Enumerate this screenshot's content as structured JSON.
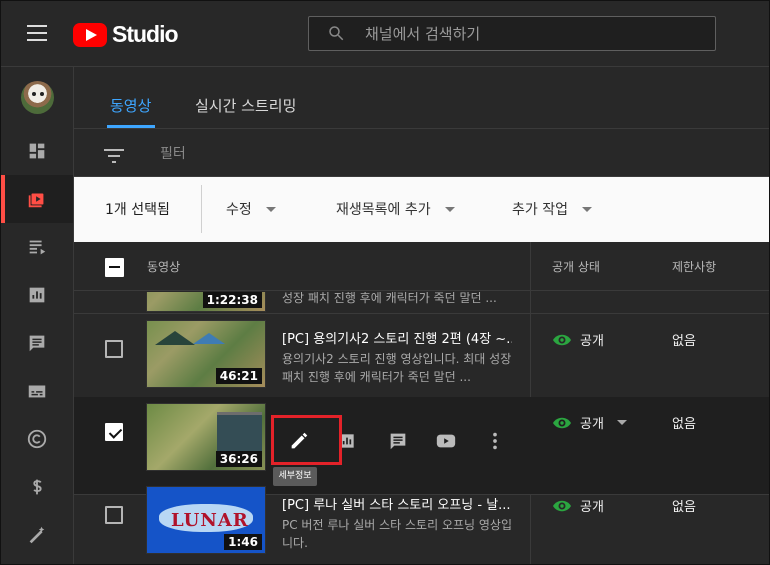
{
  "app": {
    "logo_text": "Studio"
  },
  "search": {
    "placeholder": "채널에서 검색하기"
  },
  "tabs": [
    {
      "label": "동영상"
    },
    {
      "label": "실시간 스트리밍"
    }
  ],
  "filter": {
    "label": "필터"
  },
  "actionbar": {
    "selected_count": "1개 선택됨",
    "edit_label": "수정",
    "add_to_playlist_label": "재생목록에 추가",
    "more_actions_label": "추가 작업"
  },
  "columns": {
    "video": "동영상",
    "visibility": "공개 상태",
    "restrictions": "제한사항"
  },
  "rows": [
    {
      "duration": "1:22:38",
      "desc_line": "성장 패치 진행 후에 캐릭터가 죽던 말던 ..."
    },
    {
      "title": "[PC] 용의기사2 스토리 진행 2편 (4장 ~...",
      "description": "용의기사2 스토리 진행 영상입니다. 최대 성장 패치 진행 후에 캐릭터가 죽던 말던 ...",
      "duration": "46:21",
      "visibility": "공개",
      "restrictions": "없음"
    },
    {
      "duration": "36:26",
      "visibility": "공개",
      "restrictions": "없음",
      "tooltip": "세부정보"
    },
    {
      "title": "[PC] 루나 실버 스타 스토리 오프닝 - 날...",
      "description": "PC 버전 루나 실버 스타 스토리 오프닝 영상입니다.",
      "duration": "1:46",
      "visibility": "공개",
      "restrictions": "없음",
      "thumbnail_text": "LUNAR"
    }
  ],
  "colors": {
    "brand": "#ff0000",
    "active_tab": "#3ea6ff",
    "highlight": "#e32229",
    "public": "#2ba640"
  }
}
